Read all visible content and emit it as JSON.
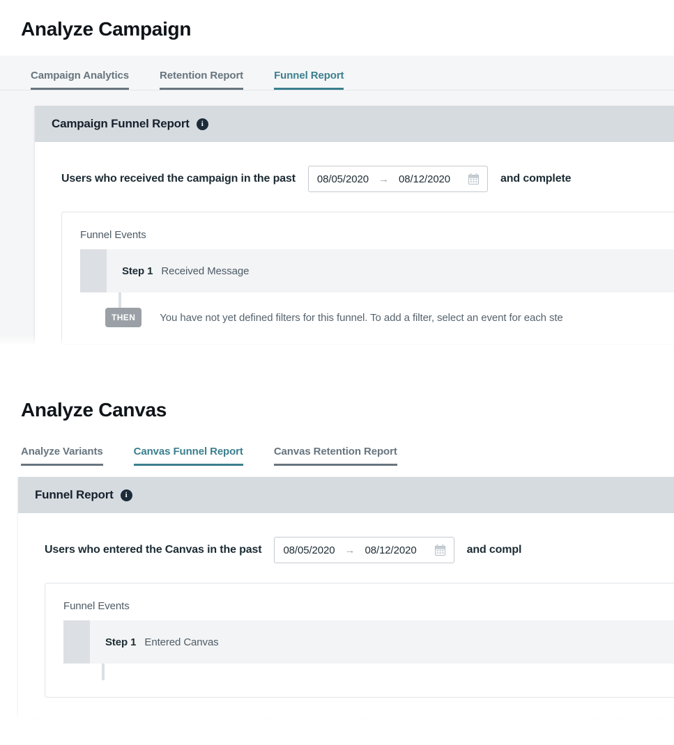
{
  "sections": [
    {
      "page_title": "Analyze Campaign",
      "tabs": [
        {
          "label": "Campaign Analytics",
          "active": false
        },
        {
          "label": "Retention Report",
          "active": false
        },
        {
          "label": "Funnel Report",
          "active": true
        }
      ],
      "card": {
        "title": "Campaign Funnel Report",
        "info_icon": "info-icon",
        "query": {
          "prefix": "Users who received the campaign in the past",
          "start_date": "08/05/2020",
          "range_arrow": "→",
          "end_date": "08/12/2020",
          "calendar_icon": "calendar-icon",
          "suffix": "and complete"
        },
        "funnel": {
          "label": "Funnel Events",
          "steps": [
            {
              "number": "Step 1",
              "event": "Received Message"
            }
          ],
          "then_badge": "THEN",
          "hint": "You have not yet defined filters for this funnel. To add a filter, select an event for each ste"
        }
      }
    },
    {
      "page_title": "Analyze Canvas",
      "tabs": [
        {
          "label": "Analyze Variants",
          "active": false
        },
        {
          "label": "Canvas Funnel Report",
          "active": true
        },
        {
          "label": "Canvas Retention Report",
          "active": false
        }
      ],
      "card": {
        "title": "Funnel Report",
        "info_icon": "info-icon",
        "query": {
          "prefix": "Users who entered the Canvas in the past",
          "start_date": "08/05/2020",
          "range_arrow": "→",
          "end_date": "08/12/2020",
          "calendar_icon": "calendar-icon",
          "suffix": "and compl"
        },
        "funnel": {
          "label": "Funnel Events",
          "steps": [
            {
              "number": "Step 1",
              "event": "Entered Canvas"
            }
          ],
          "then_badge": "",
          "hint": ""
        }
      }
    }
  ],
  "colors": {
    "accent_teal": "#3b7f8f",
    "tab_inactive": "#67757f",
    "card_header_bg": "#d6dbe0",
    "page_bg": "#f5f6f7",
    "step_row_bg": "#f3f4f5",
    "step_handle_bg": "#dcdfe3"
  }
}
